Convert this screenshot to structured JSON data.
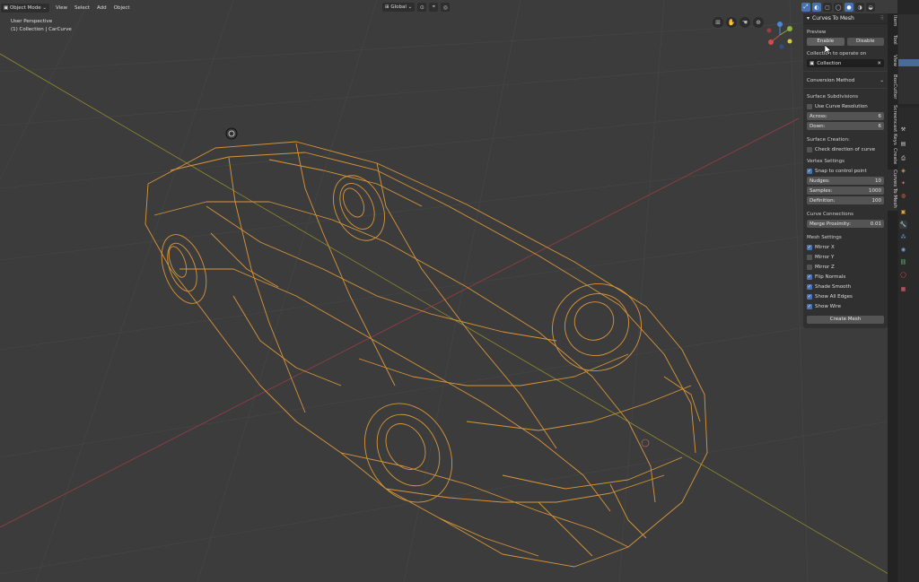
{
  "header": {
    "mode": "Object Mode",
    "menu": [
      "View",
      "Select",
      "Add",
      "Object"
    ],
    "orientation": "Global"
  },
  "viewport": {
    "view_name": "User Perspective",
    "collection_path": "(1) Collection | CarCurve"
  },
  "panel": {
    "title": "Curves To Mesh",
    "preview_label": "Preview",
    "enable_label": "Enable",
    "disable_label": "Disable",
    "collection_label": "Collection to operate on",
    "collection_value": "Collection",
    "conversion_method": "Conversion Method",
    "surface_subdivisions": "Surface Subdivisions",
    "use_curve_resolution": "Use Curve Resolution",
    "across_label": "Across:",
    "across_value": "6",
    "down_label": "Down:",
    "down_value": "6",
    "surface_creation": "Surface Creation:",
    "check_direction": "Check direction of curve",
    "vertex_settings": "Vertex Settings",
    "snap_to_control": "Snap to control point",
    "nudges_label": "Nudges:",
    "nudges_value": "10",
    "samples_label": "Samples:",
    "samples_value": "1000",
    "definition_label": "Definition:",
    "definition_value": "100",
    "curve_connections": "Curve Connections",
    "merge_label": "Merge Proximity:",
    "merge_value": "0.01",
    "mesh_settings": "Mesh Settings",
    "mirror_x": "Mirror X",
    "mirror_y": "Mirror Y",
    "mirror_z": "Mirror Z",
    "flip_normals": "Flip Normals",
    "shade_smooth": "Shade Smooth",
    "show_all_edges": "Show All Edges",
    "show_wire": "Show Wire",
    "create_mesh": "Create Mesh",
    "checks": {
      "use_curve_resolution": false,
      "check_direction": false,
      "snap_to_control": true,
      "mirror_x": true,
      "mirror_y": false,
      "mirror_z": false,
      "flip_normals": true,
      "shade_smooth": true,
      "show_all_edges": true,
      "show_wire": true
    }
  },
  "side_tabs": [
    "Item",
    "Tool",
    "View",
    "BoxCutter",
    "Screencast Keys",
    "Create",
    "Curves To Mesh"
  ],
  "colors": {
    "wire": "#d8963a",
    "x_axis": "#9a3c46",
    "y_axis": "#8f8a2e",
    "accent": "#4772b3"
  }
}
